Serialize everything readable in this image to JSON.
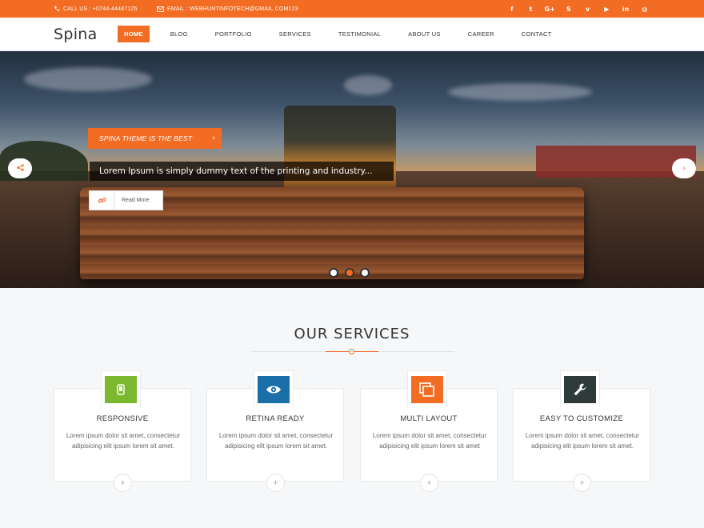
{
  "topbar": {
    "call": "CALL US : +0744-44447125",
    "email": "EMAIL :  WEBHUNTINFOTECH@GMAIL.COM123",
    "social": [
      {
        "icon": "facebook-icon",
        "glyph": "f"
      },
      {
        "icon": "twitter-icon",
        "glyph": "t"
      },
      {
        "icon": "google-plus-icon",
        "glyph": "G+"
      },
      {
        "icon": "skype-icon",
        "glyph": "S"
      },
      {
        "icon": "vimeo-icon",
        "glyph": "v"
      },
      {
        "icon": "youtube-icon",
        "glyph": "▶"
      },
      {
        "icon": "linkedin-icon",
        "glyph": "in"
      },
      {
        "icon": "dribbble-icon",
        "glyph": "◍"
      }
    ]
  },
  "header": {
    "logo": "Spina",
    "nav": [
      "HOME",
      "BLOG",
      "PORTFOLIO",
      "SERVICES",
      "TESTIMONIAL",
      "ABOUT US",
      "CAREER",
      "CONTACT"
    ],
    "active": "HOME"
  },
  "hero": {
    "badge": "SPINA THEME IS THE BEST",
    "caption": "Lorem Ipsum is simply dummy text of the printing and industry...",
    "read_more": "Read More",
    "slides": 3,
    "active_slide": 2
  },
  "services": {
    "title": "OUR SERVICES",
    "items": [
      {
        "title": "RESPONSIVE",
        "text": "Lorem ipsum dolor sit amet, consectetur adipisicing elit ipsum lorem sit amet.",
        "color": "#7cb82f",
        "icon": "mobile-icon"
      },
      {
        "title": "RETINA READY",
        "text": "Lorem ipsum dolor sit amet, consectetur adipisicing elit ipsum lorem sit amet.",
        "color": "#1a6fa8",
        "icon": "eye-icon"
      },
      {
        "title": "MULTI LAYOUT",
        "text": "Lorem ipsum dolor sit amet, consectetur adipisicing elit ipsum lorem sit amet",
        "color": "#f26c23",
        "icon": "layers-icon"
      },
      {
        "title": "EASY TO CUSTOMIZE",
        "text": "Lorem ipsum dolor sit amet, consectetur adipisicing elit ipsum lorem sit amet.",
        "color": "#2f3a3a",
        "icon": "wrench-icon"
      }
    ]
  },
  "colors": {
    "accent": "#f26c23"
  }
}
